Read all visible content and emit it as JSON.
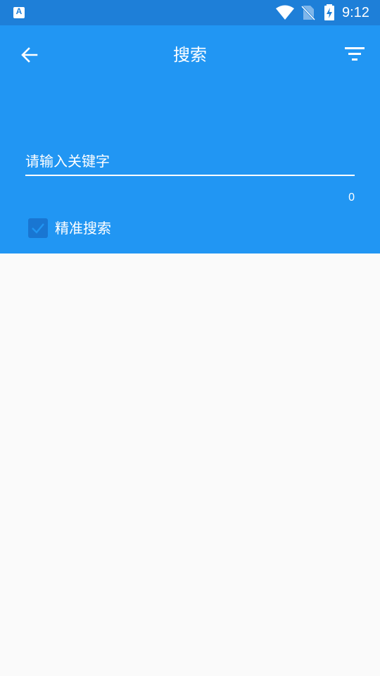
{
  "status_bar": {
    "app_icon_letter": "A",
    "time": "9:12"
  },
  "header": {
    "title": "搜索",
    "back_icon": "arrow-back-icon",
    "filter_icon": "filter-icon"
  },
  "search": {
    "placeholder": "请输入关键字",
    "value": "",
    "counter": "0"
  },
  "options": {
    "exact_label": "精准搜索",
    "exact_checked": true
  },
  "colors": {
    "primary": "#2196f3",
    "status_bar": "#1e7fd8",
    "checkbox": "#1976d2",
    "background": "#fafafa"
  }
}
